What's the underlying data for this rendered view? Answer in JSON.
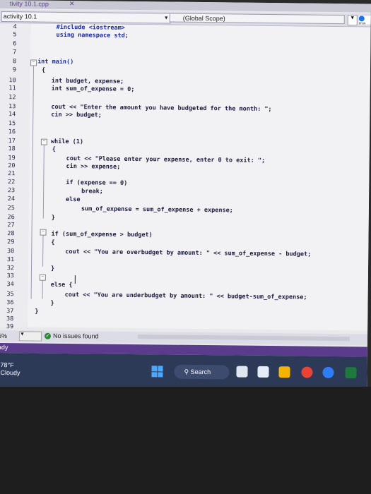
{
  "window": {
    "title": "tivity 10.1.cpp",
    "close_glyph": "✕"
  },
  "navbar": {
    "file": "activity 10.1",
    "scope": "(Global Scope)",
    "ext": "ma"
  },
  "line_numbers": [
    "4",
    "5",
    "6",
    "7",
    "8",
    "9",
    "10",
    "11",
    "12",
    "13",
    "14",
    "15",
    "16",
    "17",
    "18",
    "19",
    "20",
    "21",
    "22",
    "23",
    "24",
    "25",
    "26",
    "27",
    "28",
    "29",
    "30",
    "31",
    "32",
    "33",
    "34",
    "35",
    "36",
    "37",
    "38",
    "39"
  ],
  "code": {
    "l4": "#include <iostream>",
    "l5": "using namespace std;",
    "l8": "int main()",
    "l9": "{",
    "l10": "int budget, expense;",
    "l11": "int sum_of_expense = 0;",
    "l13": "cout << \"Enter the amount you have budgeted for the month: \";",
    "l14": "cin >> budget;",
    "l17": "while (1)",
    "l18": "{",
    "l19": "cout << \"Please enter your expense, enter 0 to exit: \";",
    "l20": "cin >> expense;",
    "l22": "if (expense == 0)",
    "l23": "break;",
    "l24": "else",
    "l25": "sum_of_expense = sum_of_expense + expense;",
    "l26": "}",
    "l28": "if (sum_of_expense > budget)",
    "l29": "{",
    "l30": "cout << \"You are overbudget by amount: \" << sum_of_expense - budget;",
    "l32": "}",
    "l34": "else {",
    "l35": "cout << \"You are underbudget by amount: \" << budget-sum_of_expense;",
    "l36": "}",
    "l37": "}"
  },
  "status": {
    "zoom": "5%",
    "issues": "No issues found",
    "ready": "ady"
  },
  "taskbar": {
    "temp": "78°F",
    "condition": "Cloudy",
    "search": "Search"
  },
  "colors": {
    "keyword": "#1b2b9e",
    "string": "#8a2b2b",
    "taskbar": "#2c3a58",
    "status_accent": "#5a3b8c"
  }
}
